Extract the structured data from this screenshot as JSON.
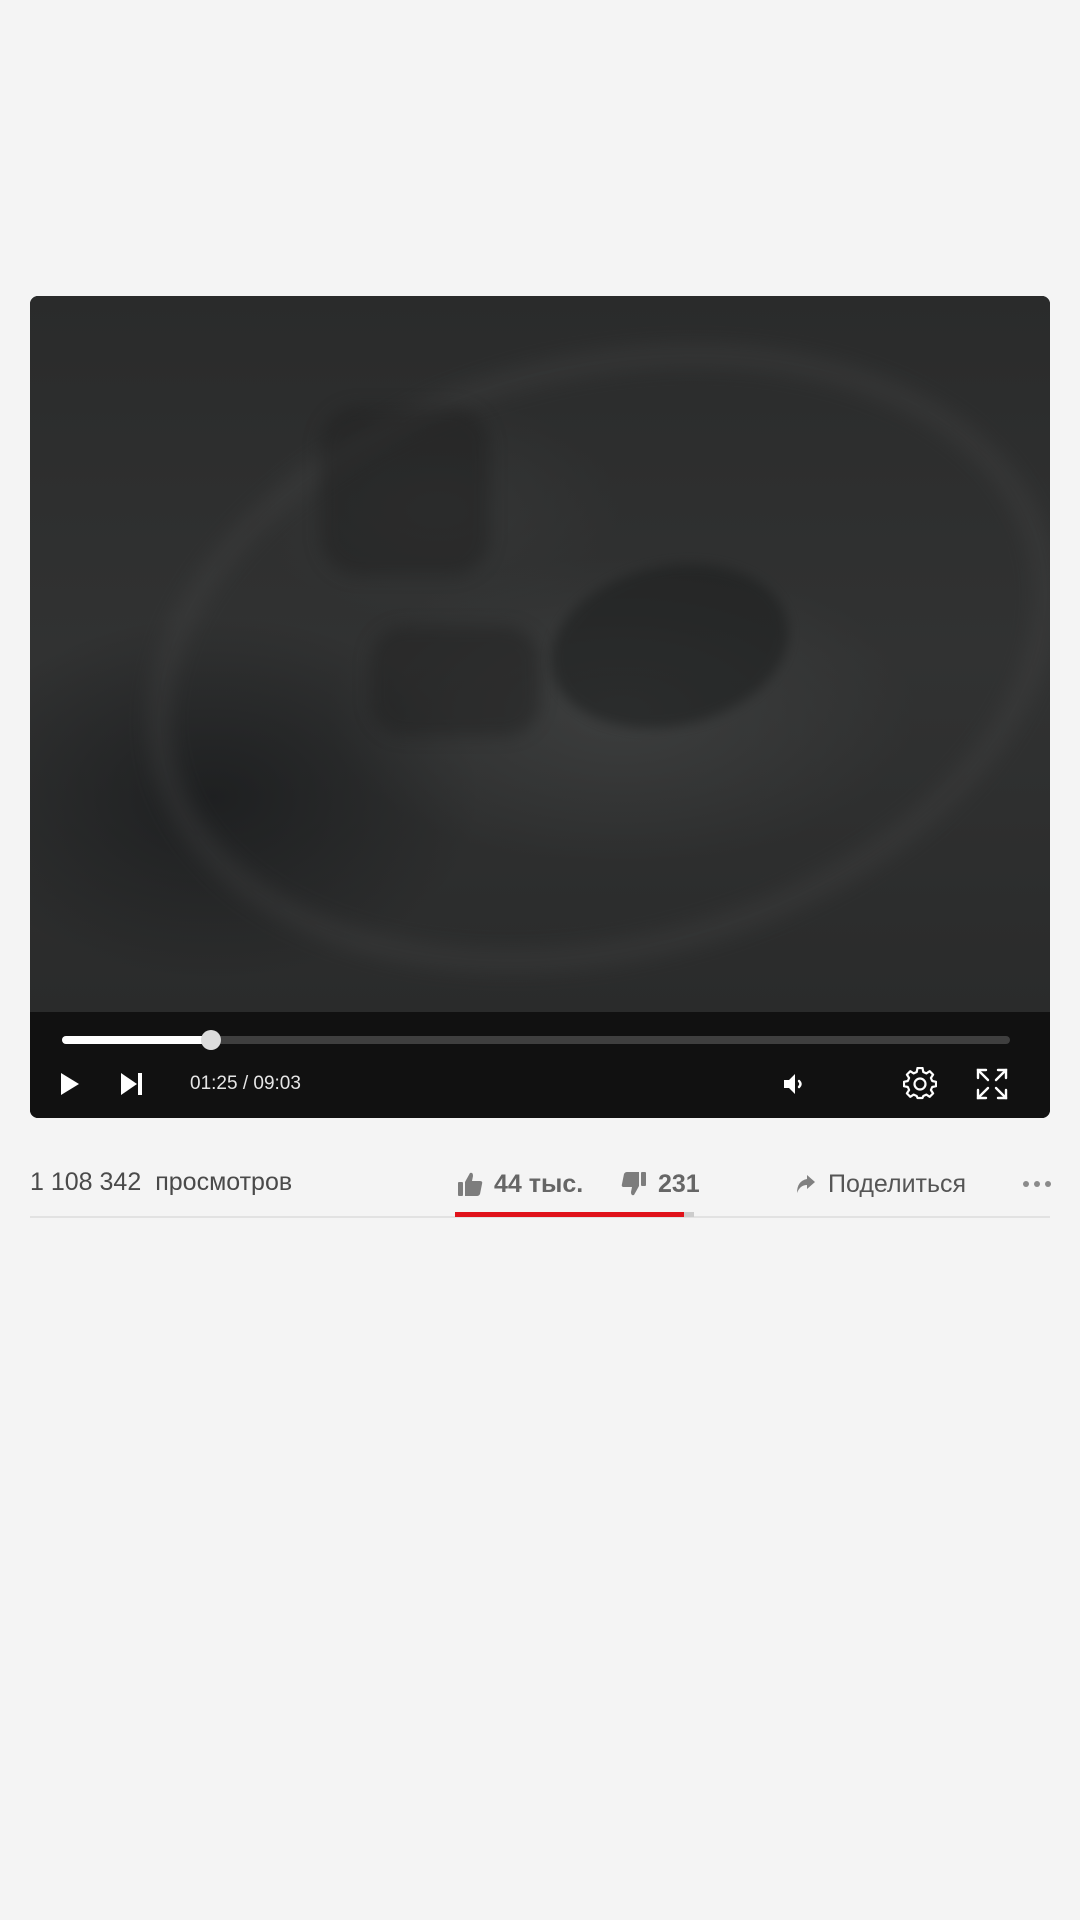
{
  "player": {
    "current_time": "01:25",
    "duration": "09:03",
    "time_display": "01:25 / 09:03",
    "progress_fraction": 0.157,
    "buttons": {
      "play": "play-icon",
      "next": "skip-next-icon",
      "volume": "volume-icon",
      "settings": "gear-icon",
      "fullscreen": "fullscreen-icon"
    }
  },
  "stats": {
    "views_count": "1 108 342",
    "views_label": "просмотров",
    "likes": "44 тыс.",
    "dislikes": "231",
    "share_label": "Поделиться",
    "like_ratio": 0.96
  },
  "colors": {
    "background": "#f4f4f4",
    "accent": "#e0121a",
    "controls_bg": "#111111"
  }
}
